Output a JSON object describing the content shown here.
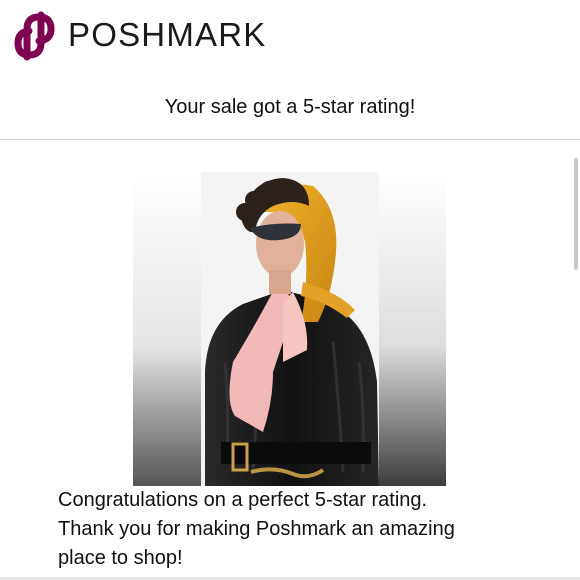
{
  "header": {
    "brand_name": "POSHMARK",
    "logo_icon": "poshmark-logo-icon",
    "brand_color": "#7f0353"
  },
  "headline": "Your sale got a 5-star rating!",
  "product_image": {
    "icon": "product-photo-scarf"
  },
  "message": {
    "line1": "Congratulations on a perfect 5-star rating.",
    "line2": "Thank you for making Poshmark an amazing",
    "line3": "place to shop!"
  }
}
